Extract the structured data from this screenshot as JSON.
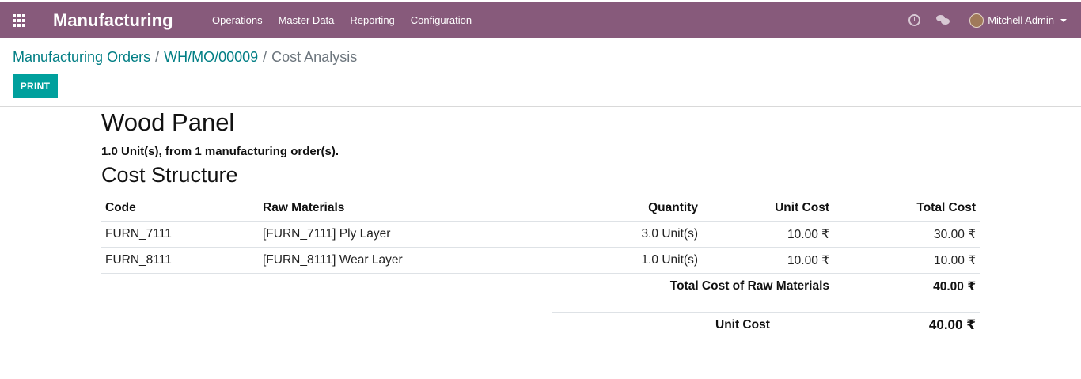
{
  "navbar": {
    "app_name": "Manufacturing",
    "menu": [
      "Operations",
      "Master Data",
      "Reporting",
      "Configuration"
    ],
    "user_name": "Mitchell Admin",
    "color": "#875a7b"
  },
  "breadcrumb": {
    "items": [
      "Manufacturing Orders",
      "WH/MO/00009"
    ],
    "separator": "/",
    "current": "Cost Analysis"
  },
  "toolbar": {
    "print_label": "PRINT",
    "button_color": "#00a09d"
  },
  "report": {
    "product": "Wood Panel",
    "summary": "1.0 Unit(s), from 1 manufacturing order(s).",
    "section_title": "Cost Structure",
    "columns": [
      "Code",
      "Raw Materials",
      "Quantity",
      "Unit Cost",
      "Total Cost"
    ],
    "rows": [
      {
        "code": "FURN_7111",
        "material": "[FURN_7111] Ply Layer",
        "quantity": "3.0 Unit(s)",
        "unit_cost": "10.00 ₹",
        "total_cost": "30.00 ₹"
      },
      {
        "code": "FURN_8111",
        "material": "[FURN_8111] Wear Layer",
        "quantity": "1.0 Unit(s)",
        "unit_cost": "10.00 ₹",
        "total_cost": "10.00 ₹"
      }
    ],
    "total_label": "Total Cost of Raw Materials",
    "total_value": "40.00 ₹",
    "unit_cost_label": "Unit Cost",
    "unit_cost_value": "40.00 ₹"
  }
}
